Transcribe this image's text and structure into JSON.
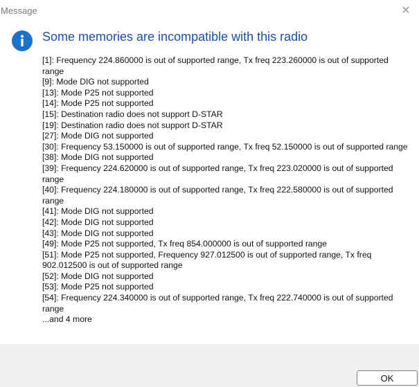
{
  "window": {
    "title": "Message",
    "close_glyph": "✕"
  },
  "dialog": {
    "icon": "info-icon",
    "heading": "Some memories are incompatible with this radio",
    "messages": [
      "[1]: Frequency 224.860000 is out of supported range, Tx freq 223.260000 is out of supported range",
      "[9]: Mode DIG not supported",
      "[13]: Mode P25 not supported",
      "[14]: Mode P25 not supported",
      "[15]: Destination radio does not support D-STAR",
      "[19]: Destination radio does not support D-STAR",
      "[27]: Mode DIG not supported",
      "[30]: Frequency 53.150000 is out of supported range, Tx freq 52.150000 is out of supported range",
      "[38]: Mode DIG not supported",
      "[39]: Frequency 224.620000 is out of supported range, Tx freq 223.020000 is out of supported range",
      "[40]: Frequency 224.180000 is out of supported range, Tx freq 222.580000 is out of supported range",
      "[41]: Mode DIG not supported",
      "[42]: Mode DIG not supported",
      "[43]: Mode DIG not supported",
      "[49]: Mode P25 not supported, Tx freq 854.000000 is out of supported range",
      "[51]: Mode P25 not supported, Frequency 927.012500 is out of supported range, Tx freq 902.012500 is out of supported range",
      "[52]: Mode DIG not supported",
      "[53]: Mode P25 not supported",
      "[54]: Frequency 224.340000 is out of supported range, Tx freq 222.740000 is out of supported range",
      "...and 4 more"
    ]
  },
  "footer": {
    "ok_label": "OK"
  },
  "colors": {
    "accent": "#1a73c8",
    "heading": "#1b4fa6",
    "footer_bg": "#f0f0f0"
  }
}
